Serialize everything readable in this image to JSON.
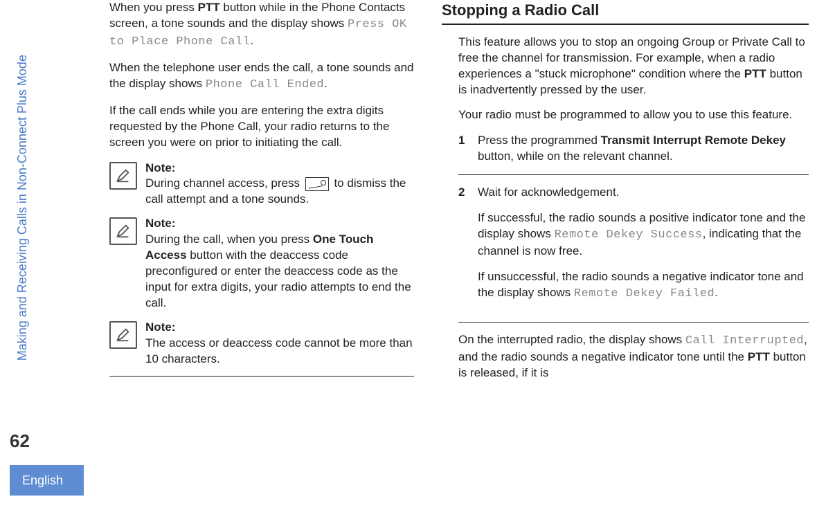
{
  "sidebar": {
    "section_title": "Making and Receiving Calls in Non-Connect Plus Mode",
    "page_number": "62",
    "language": "English"
  },
  "col1": {
    "p1_a": "When you press ",
    "p1_ptt": "PTT",
    "p1_b": " button while in the Phone Contacts screen, a tone sounds and the display shows ",
    "p1_mono": "Press OK to Place Phone Call",
    "p1_c": ".",
    "p2_a": "When the telephone user ends the call, a tone sounds and the display shows ",
    "p2_mono": "Phone Call Ended",
    "p2_b": ".",
    "p3": "If the call ends while you are entering the extra digits requested by the Phone Call, your radio returns to the screen you were on prior to initiating the call.",
    "note_label": "Note:",
    "note1_a": "During channel access, press ",
    "note1_b": " to dismiss the call attempt and a tone sounds.",
    "note2_a": "During the call, when you press ",
    "note2_ota": "One Touch Access",
    "note2_b": " button with the deaccess code preconfigured or enter the deaccess code as the input for extra digits, your radio attempts to end the call.",
    "note3": "The access or deaccess code cannot be more than 10 characters."
  },
  "col2": {
    "heading": "Stopping a Radio Call",
    "p1_a": "This feature allows you to stop an ongoing Group or Private Call to free the channel for transmission. For example, when a radio experiences a \"stuck microphone\" condition where the ",
    "p1_ptt": "PTT",
    "p1_b": " button is inadvertently pressed by the user.",
    "p2": "Your radio must be programmed to allow you to use this feature.",
    "step1_num": "1",
    "step1_a": "Press the programmed ",
    "step1_btn": "Transmit Interrupt Remote Dekey",
    "step1_b": " button, while on the relevant channel.",
    "step2_num": "2",
    "step2_a": "Wait for acknowledgement.",
    "step2_b1": "If successful, the radio sounds a positive indicator tone and the display shows ",
    "step2_mono1": "Remote Dekey Success",
    "step2_b2": ", indicating that the channel is now free.",
    "step2_c1": "If unsuccessful, the radio sounds a negative indicator tone and the display shows ",
    "step2_mono2": "Remote Dekey Failed",
    "step2_c2": ".",
    "p3_a": "On the interrupted radio, the display shows ",
    "p3_mono": "Call Interrupted",
    "p3_b": ", and the radio sounds a negative indicator tone until the ",
    "p3_ptt": "PTT",
    "p3_c": " button is released, if it is"
  }
}
